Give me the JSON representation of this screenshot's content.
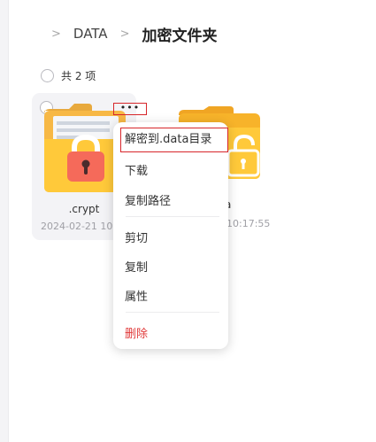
{
  "breadcrumb": {
    "separator": ">",
    "items": [
      "DATA"
    ],
    "current": "加密文件夹"
  },
  "toolbar": {
    "count_label": "共 2 项"
  },
  "files": [
    {
      "name": ".crypt",
      "date": "2024-02-21 10:17:55",
      "more": "•••"
    },
    {
      "name": "a",
      "date": "10:17:55"
    }
  ],
  "context_menu": {
    "items": [
      "解密到.data目录",
      "下载",
      "复制路径",
      "剪切",
      "复制",
      "属性",
      "删除"
    ]
  },
  "colors": {
    "folder_yellow": "#ffc93a",
    "lock_red": "#f56a5a",
    "danger_text": "#e03a3a",
    "highlight_border": "#d7262b"
  }
}
